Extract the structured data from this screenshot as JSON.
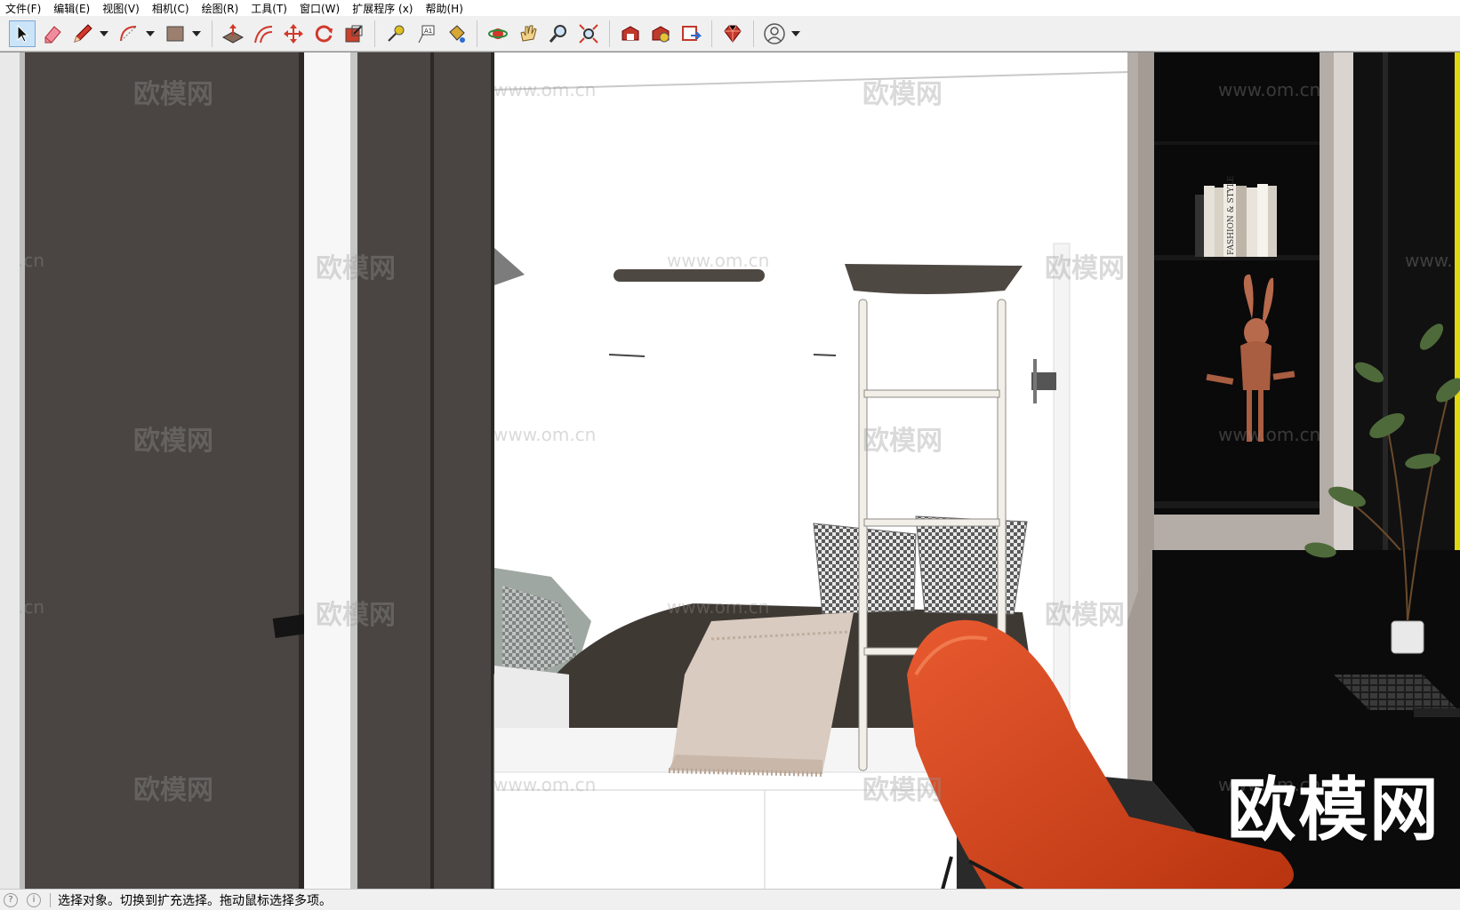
{
  "menubar": {
    "items": [
      "文件(F)",
      "编辑(E)",
      "视图(V)",
      "相机(C)",
      "绘图(R)",
      "工具(T)",
      "窗口(W)",
      "扩展程序 (x)",
      "帮助(H)"
    ]
  },
  "toolbar": {
    "buttons": [
      {
        "name": "select-tool",
        "icon": "arrow-cursor-icon",
        "active": true
      },
      {
        "name": "eraser-tool",
        "icon": "eraser-icon"
      },
      {
        "name": "line-tool",
        "icon": "pencil-icon",
        "dropdown": true
      },
      {
        "name": "arc-tool",
        "icon": "arc-icon",
        "dropdown": true
      },
      {
        "name": "rectangle-tool",
        "icon": "rectangle-icon",
        "dropdown": true
      },
      {
        "name": "push-pull-tool",
        "icon": "push-pull-icon"
      },
      {
        "name": "offset-tool",
        "icon": "offset-icon"
      },
      {
        "name": "move-tool",
        "icon": "move-icon"
      },
      {
        "name": "rotate-tool",
        "icon": "rotate-icon"
      },
      {
        "name": "scale-tool",
        "icon": "scale-icon"
      },
      {
        "name": "tape-measure-tool",
        "icon": "tape-measure-icon"
      },
      {
        "name": "text-tool",
        "icon": "text-icon"
      },
      {
        "name": "paint-bucket-tool",
        "icon": "paint-bucket-icon"
      },
      {
        "name": "orbit-tool",
        "icon": "orbit-icon"
      },
      {
        "name": "pan-tool",
        "icon": "pan-hand-icon"
      },
      {
        "name": "zoom-tool",
        "icon": "zoom-icon"
      },
      {
        "name": "zoom-extents-tool",
        "icon": "zoom-extents-icon"
      },
      {
        "name": "warehouse-tool",
        "icon": "warehouse-icon"
      },
      {
        "name": "extension-warehouse-tool",
        "icon": "extension-warehouse-icon"
      },
      {
        "name": "layout-tool",
        "icon": "layout-icon"
      },
      {
        "name": "ruby-console-tool",
        "icon": "ruby-gem-icon"
      },
      {
        "name": "account-button",
        "icon": "user-account-icon",
        "dropdown": true
      }
    ]
  },
  "watermarks": {
    "cn": "欧模网",
    "url": "www.om.cn",
    "partial_url": ".cn",
    "partial_url_right": "www."
  },
  "brand_watermark": "欧模网",
  "books": {
    "spine_text": "FASHION & STYLE"
  },
  "statusbar": {
    "icon1": "?",
    "icon2": "i",
    "message": "选择对象。切换到扩充选择。拖动鼠标选择多项。"
  },
  "colors": {
    "chair": "#d9441e",
    "wall_dark": "#4a4542",
    "shelf_black": "#0a0a0a",
    "bunny": "#b86a4c"
  }
}
